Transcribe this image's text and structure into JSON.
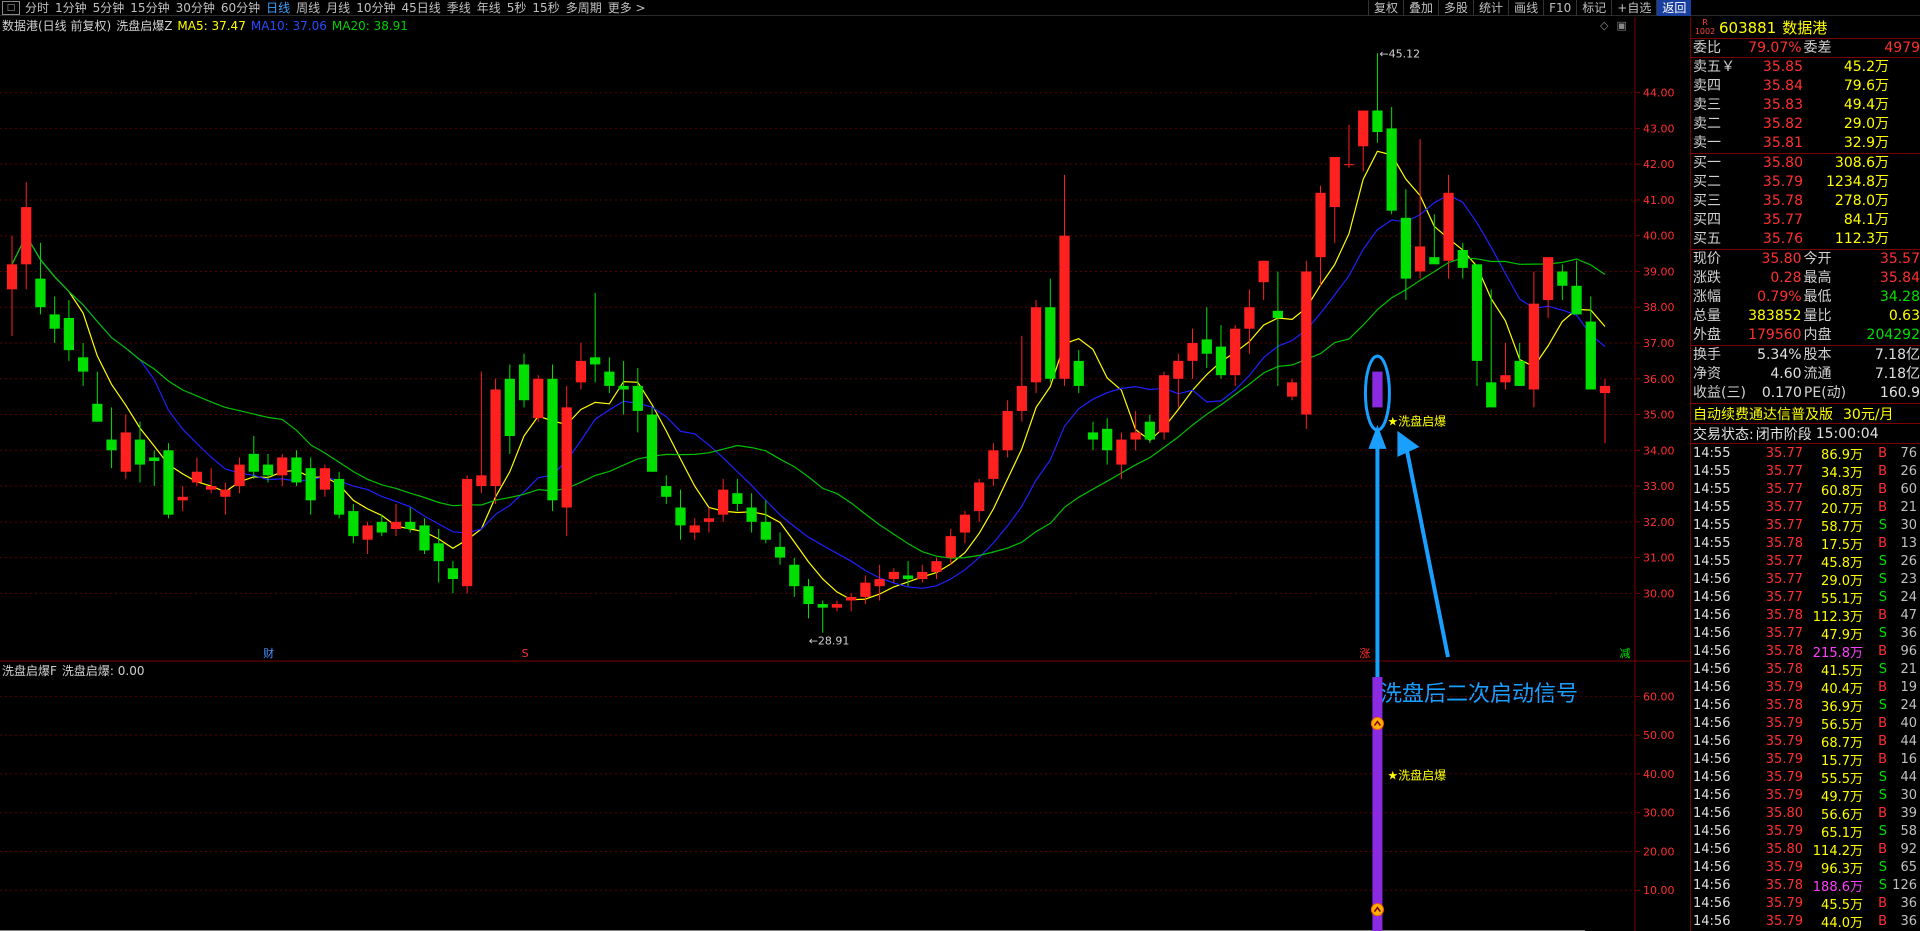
{
  "topbar": {
    "menu_icon": "menu-icon",
    "period_tabs": [
      "分时",
      "1分钟",
      "5分钟",
      "15分钟",
      "30分钟",
      "60分钟",
      "日线",
      "周线",
      "月线",
      "10分钟",
      "45日线",
      "季线",
      "年线",
      "5秒",
      "15秒",
      "多周期",
      "更多 >"
    ],
    "active_index": 6,
    "tool_tabs": [
      "复权",
      "叠加",
      "多股",
      "统计",
      "画线",
      "F10",
      "标记",
      "+自选",
      "返回"
    ]
  },
  "main_legend": {
    "name": "数据港(日线 前复权)",
    "indicator": "洗盘启爆Z",
    "ma5": "MA5: 37.47",
    "ma10": "MA10: 37.06",
    "ma20": "MA20: 38.91"
  },
  "sub_legend": {
    "name": "洗盘启爆F",
    "value": "洗盘启爆: 0.00"
  },
  "colors": {
    "up": "#ff2020",
    "down": "#00e000",
    "ma5": "#ffff00",
    "ma10": "#2020ff",
    "ma20": "#00c000",
    "signal": "#8a2be2",
    "annotation": "#1a9fff",
    "grid": "#5a0000"
  },
  "chart_data": [
    {
      "type": "candlestick",
      "title": "数据港(日线 前复权)",
      "ylim": [
        28.5,
        45.5
      ],
      "y_ticks": [
        "30.00",
        "31.00",
        "32.00",
        "33.00",
        "34.00",
        "35.00",
        "36.00",
        "37.00",
        "38.00",
        "39.00",
        "40.00",
        "41.00",
        "42.00",
        "43.00",
        "44.00"
      ],
      "candles": [
        [
          38.5,
          40.0,
          37.2,
          39.2
        ],
        [
          39.2,
          41.5,
          38.5,
          40.8
        ],
        [
          38.8,
          39.8,
          37.8,
          38.0
        ],
        [
          37.8,
          38.3,
          37.0,
          37.4
        ],
        [
          37.7,
          38.2,
          36.5,
          36.8
        ],
        [
          36.6,
          37.0,
          35.8,
          36.2
        ],
        [
          35.3,
          36.2,
          34.8,
          34.8
        ],
        [
          34.3,
          35.2,
          33.5,
          34.0
        ],
        [
          33.4,
          35.0,
          33.2,
          34.5
        ],
        [
          34.3,
          34.8,
          33.1,
          33.6
        ],
        [
          33.8,
          34.0,
          33.0,
          33.7
        ],
        [
          34.0,
          34.2,
          32.1,
          32.2
        ],
        [
          32.6,
          33.0,
          32.3,
          32.7
        ],
        [
          33.1,
          33.8,
          33.0,
          33.4
        ],
        [
          32.9,
          33.5,
          32.8,
          33.0
        ],
        [
          32.7,
          33.1,
          32.2,
          32.9
        ],
        [
          33.0,
          33.8,
          32.8,
          33.6
        ],
        [
          33.9,
          34.4,
          33.2,
          33.4
        ],
        [
          33.6,
          33.9,
          33.1,
          33.3
        ],
        [
          33.3,
          33.9,
          33.0,
          33.8
        ],
        [
          33.8,
          34.0,
          33.0,
          33.1
        ],
        [
          33.5,
          33.8,
          32.2,
          32.6
        ],
        [
          32.9,
          33.6,
          32.7,
          33.5
        ],
        [
          33.2,
          33.4,
          32.1,
          32.2
        ],
        [
          32.3,
          32.5,
          31.4,
          31.6
        ],
        [
          31.5,
          32.0,
          31.1,
          31.9
        ],
        [
          32.0,
          32.2,
          31.6,
          31.7
        ],
        [
          31.8,
          32.5,
          31.6,
          32.0
        ],
        [
          32.0,
          32.4,
          31.7,
          31.8
        ],
        [
          31.9,
          32.1,
          31.1,
          31.2
        ],
        [
          31.4,
          31.8,
          30.3,
          30.9
        ],
        [
          30.7,
          30.9,
          30.0,
          30.4
        ],
        [
          30.2,
          33.3,
          30.0,
          33.2
        ],
        [
          33.0,
          36.2,
          32.8,
          33.3
        ],
        [
          33.0,
          36.0,
          32.5,
          35.7
        ],
        [
          36.0,
          36.4,
          33.9,
          34.4
        ],
        [
          36.4,
          36.7,
          35.2,
          35.4
        ],
        [
          34.9,
          36.1,
          34.8,
          36.0
        ],
        [
          36.0,
          36.4,
          32.3,
          32.6
        ],
        [
          32.4,
          35.8,
          31.6,
          35.2
        ],
        [
          35.9,
          37.0,
          35.7,
          36.5
        ],
        [
          36.6,
          38.4,
          35.9,
          36.4
        ],
        [
          36.2,
          36.6,
          35.6,
          35.8
        ],
        [
          35.8,
          36.5,
          35.0,
          35.7
        ],
        [
          35.8,
          36.3,
          34.5,
          35.1
        ],
        [
          35.0,
          35.2,
          33.4,
          33.4
        ],
        [
          33.0,
          33.3,
          32.5,
          32.7
        ],
        [
          32.4,
          32.9,
          31.5,
          31.9
        ],
        [
          31.7,
          32.1,
          31.5,
          31.9
        ],
        [
          32.0,
          32.4,
          31.7,
          32.1
        ],
        [
          32.2,
          33.2,
          32.0,
          32.9
        ],
        [
          32.8,
          33.2,
          32.3,
          32.5
        ],
        [
          32.4,
          32.8,
          31.7,
          32.0
        ],
        [
          32.0,
          32.6,
          31.4,
          31.5
        ],
        [
          31.3,
          31.7,
          30.8,
          31.0
        ],
        [
          30.8,
          31.0,
          29.9,
          30.2
        ],
        [
          30.2,
          30.4,
          29.3,
          29.7
        ],
        [
          29.7,
          29.8,
          28.9,
          29.6
        ],
        [
          29.6,
          29.8,
          29.5,
          29.7
        ],
        [
          29.8,
          30.0,
          29.5,
          29.9
        ],
        [
          29.9,
          30.5,
          29.7,
          30.3
        ],
        [
          30.2,
          30.8,
          29.8,
          30.4
        ],
        [
          30.4,
          30.7,
          30.3,
          30.6
        ],
        [
          30.5,
          30.9,
          30.2,
          30.4
        ],
        [
          30.4,
          30.8,
          30.3,
          30.6
        ],
        [
          30.6,
          31.0,
          30.4,
          30.9
        ],
        [
          31.0,
          31.8,
          30.8,
          31.6
        ],
        [
          31.7,
          32.3,
          31.4,
          32.2
        ],
        [
          32.3,
          33.2,
          32.0,
          33.1
        ],
        [
          33.2,
          34.2,
          33.0,
          34.0
        ],
        [
          34.0,
          35.4,
          33.8,
          35.1
        ],
        [
          35.1,
          37.2,
          34.8,
          35.8
        ],
        [
          35.9,
          38.2,
          35.6,
          38.0
        ],
        [
          38.0,
          38.8,
          35.9,
          36.0
        ],
        [
          36.0,
          41.7,
          35.8,
          40.0
        ],
        [
          36.5,
          36.8,
          35.6,
          35.8
        ],
        [
          34.5,
          34.8,
          34.0,
          34.3
        ],
        [
          34.6,
          34.9,
          33.6,
          34.0
        ],
        [
          33.6,
          34.5,
          33.2,
          34.3
        ],
        [
          34.3,
          35.1,
          34.0,
          34.5
        ],
        [
          34.8,
          35.0,
          34.2,
          34.3
        ],
        [
          34.5,
          36.2,
          34.3,
          36.1
        ],
        [
          36.0,
          36.7,
          35.2,
          36.5
        ],
        [
          36.5,
          37.4,
          36.0,
          37.0
        ],
        [
          37.1,
          38.0,
          36.3,
          36.7
        ],
        [
          36.9,
          37.5,
          36.0,
          36.1
        ],
        [
          36.1,
          37.5,
          35.8,
          37.4
        ],
        [
          37.4,
          38.5,
          36.7,
          38.0
        ],
        [
          38.7,
          39.2,
          38.2,
          39.3
        ],
        [
          37.9,
          39.0,
          35.8,
          37.7
        ],
        [
          35.5,
          36.0,
          35.4,
          35.9
        ],
        [
          35.0,
          39.3,
          34.6,
          39.0
        ],
        [
          39.4,
          41.4,
          38.6,
          41.2
        ],
        [
          40.8,
          42.1,
          39.8,
          42.2
        ],
        [
          42.0,
          43.1,
          41.9,
          42.0
        ],
        [
          42.5,
          43.5,
          41.8,
          43.5
        ],
        [
          43.5,
          45.1,
          42.6,
          42.9
        ],
        [
          43.0,
          43.6,
          40.6,
          40.7
        ],
        [
          40.5,
          41.3,
          38.2,
          38.8
        ],
        [
          39.0,
          42.7,
          38.8,
          39.7
        ],
        [
          39.4,
          40.6,
          39.3,
          39.2
        ],
        [
          39.3,
          41.7,
          38.8,
          41.2
        ],
        [
          39.6,
          39.8,
          38.8,
          39.1
        ],
        [
          39.2,
          38.6,
          35.8,
          36.5
        ],
        [
          35.9,
          38.5,
          35.7,
          35.2
        ],
        [
          35.9,
          37.0,
          35.7,
          36.1
        ],
        [
          36.5,
          37.0,
          35.8,
          35.8
        ],
        [
          35.7,
          39.0,
          35.2,
          38.1
        ],
        [
          38.2,
          39.4,
          37.7,
          39.4
        ],
        [
          39.0,
          39.2,
          38.2,
          38.6
        ],
        [
          38.6,
          39.3,
          37.8,
          37.8
        ],
        [
          37.6,
          38.3,
          36.7,
          35.7
        ],
        [
          35.6,
          36.0,
          34.2,
          35.8
        ]
      ],
      "labels": [
        {
          "text": "45.12",
          "kind": "high"
        },
        {
          "text": "28.91",
          "kind": "low"
        },
        {
          "text": "财",
          "kind": "event"
        },
        {
          "text": "S",
          "kind": "event"
        },
        {
          "text": "涨",
          "kind": "event"
        },
        {
          "text": "减",
          "kind": "event"
        },
        {
          "text": "洗盘启爆",
          "kind": "signal"
        }
      ]
    },
    {
      "type": "bar",
      "title": "洗盘启爆F",
      "ylim": [
        0,
        65
      ],
      "y_ticks": [
        "10.00",
        "20.00",
        "30.00",
        "40.00",
        "50.00",
        "60.00"
      ],
      "signal_index": 96,
      "signal_value": 65,
      "label": "洗盘启爆"
    }
  ],
  "annotation": {
    "text": "洗盘后二次启动信号"
  },
  "quote": {
    "badge": "R\n1002",
    "code": "603881",
    "name": "数据港",
    "weibi": {
      "label": "委比",
      "value": "79.07%",
      "label2": "委差",
      "value2": "4979"
    },
    "sell": [
      {
        "label": "卖五￥",
        "price": "35.85",
        "vol": "45.2万"
      },
      {
        "label": "卖四",
        "price": "35.84",
        "vol": "79.6万"
      },
      {
        "label": "卖三",
        "price": "35.83",
        "vol": "49.4万"
      },
      {
        "label": "卖二",
        "price": "35.82",
        "vol": "29.0万"
      },
      {
        "label": "卖一",
        "price": "35.81",
        "vol": "32.9万"
      }
    ],
    "buy": [
      {
        "label": "买一",
        "price": "35.80",
        "vol": "308.6万"
      },
      {
        "label": "买二",
        "price": "35.79",
        "vol": "1234.8万"
      },
      {
        "label": "买三",
        "price": "35.78",
        "vol": "278.0万"
      },
      {
        "label": "买四",
        "price": "35.77",
        "vol": "84.1万"
      },
      {
        "label": "买五",
        "price": "35.76",
        "vol": "112.3万"
      }
    ],
    "stats1": [
      {
        "l1": "现价",
        "v1": "35.80",
        "c1": "red",
        "l2": "今开",
        "v2": "35.57",
        "c2": "red"
      },
      {
        "l1": "涨跌",
        "v1": "0.28",
        "c1": "red",
        "l2": "最高",
        "v2": "35.84",
        "c2": "red"
      },
      {
        "l1": "涨幅",
        "v1": "0.79%",
        "c1": "red",
        "l2": "最低",
        "v2": "34.28",
        "c2": "green"
      },
      {
        "l1": "总量",
        "v1": "383852",
        "c1": "yellow",
        "l2": "量比",
        "v2": "0.63",
        "c2": "yellow"
      },
      {
        "l1": "外盘",
        "v1": "179560",
        "c1": "red",
        "l2": "内盘",
        "v2": "204292",
        "c2": "green"
      }
    ],
    "stats2": [
      {
        "l1": "换手",
        "v1": "5.34%",
        "c1": "white",
        "l2": "股本",
        "v2": "7.18亿",
        "c2": "white"
      },
      {
        "l1": "净资",
        "v1": "4.60",
        "c1": "white",
        "l2": "流通",
        "v2": "7.18亿",
        "c2": "white"
      },
      {
        "l1": "收益(三)",
        "v1": "0.170",
        "c1": "white",
        "l2": "PE(动)",
        "v2": "160.9",
        "c2": "white"
      }
    ],
    "ad_text": "自动续费通达信普及版",
    "ad_price": "30元/月",
    "status_label": "交易状态:",
    "status_value": "闭市阶段",
    "status_time": "15:00:04",
    "ticks": [
      {
        "time": "14:55",
        "price": "35.77",
        "vol": "86.9万",
        "bs": "B",
        "cnt": "76"
      },
      {
        "time": "14:55",
        "price": "35.77",
        "vol": "34.3万",
        "bs": "B",
        "cnt": "26"
      },
      {
        "time": "14:55",
        "price": "35.77",
        "vol": "60.8万",
        "bs": "B",
        "cnt": "60"
      },
      {
        "time": "14:55",
        "price": "35.77",
        "vol": "20.7万",
        "bs": "B",
        "cnt": "21"
      },
      {
        "time": "14:55",
        "price": "35.77",
        "vol": "58.7万",
        "bs": "S",
        "cnt": "30"
      },
      {
        "time": "14:55",
        "price": "35.78",
        "vol": "17.5万",
        "bs": "B",
        "cnt": "13"
      },
      {
        "time": "14:55",
        "price": "35.77",
        "vol": "45.8万",
        "bs": "S",
        "cnt": "26"
      },
      {
        "time": "14:56",
        "price": "35.77",
        "vol": "29.0万",
        "bs": "S",
        "cnt": "23"
      },
      {
        "time": "14:56",
        "price": "35.77",
        "vol": "55.1万",
        "bs": "S",
        "cnt": "24"
      },
      {
        "time": "14:56",
        "price": "35.78",
        "vol": "112.3万",
        "bs": "B",
        "cnt": "47"
      },
      {
        "time": "14:56",
        "price": "35.77",
        "vol": "47.9万",
        "bs": "S",
        "cnt": "36"
      },
      {
        "time": "14:56",
        "price": "35.78",
        "vol": "215.8万",
        "bs": "B",
        "cnt": "96"
      },
      {
        "time": "14:56",
        "price": "35.78",
        "vol": "41.5万",
        "bs": "S",
        "cnt": "21"
      },
      {
        "time": "14:56",
        "price": "35.79",
        "vol": "40.4万",
        "bs": "B",
        "cnt": "19"
      },
      {
        "time": "14:56",
        "price": "35.78",
        "vol": "36.9万",
        "bs": "S",
        "cnt": "24"
      },
      {
        "time": "14:56",
        "price": "35.79",
        "vol": "56.5万",
        "bs": "B",
        "cnt": "40"
      },
      {
        "time": "14:56",
        "price": "35.79",
        "vol": "68.7万",
        "bs": "B",
        "cnt": "44"
      },
      {
        "time": "14:56",
        "price": "35.79",
        "vol": "15.7万",
        "bs": "B",
        "cnt": "16"
      },
      {
        "time": "14:56",
        "price": "35.79",
        "vol": "55.5万",
        "bs": "S",
        "cnt": "44"
      },
      {
        "time": "14:56",
        "price": "35.79",
        "vol": "49.7万",
        "bs": "S",
        "cnt": "30"
      },
      {
        "time": "14:56",
        "price": "35.80",
        "vol": "56.6万",
        "bs": "B",
        "cnt": "39"
      },
      {
        "time": "14:56",
        "price": "35.79",
        "vol": "65.1万",
        "bs": "S",
        "cnt": "58"
      },
      {
        "time": "14:56",
        "price": "35.80",
        "vol": "114.2万",
        "bs": "B",
        "cnt": "92"
      },
      {
        "time": "14:56",
        "price": "35.79",
        "vol": "96.3万",
        "bs": "S",
        "cnt": "65"
      },
      {
        "time": "14:56",
        "price": "35.78",
        "vol": "188.6万",
        "bs": "S",
        "cnt": "126"
      },
      {
        "time": "14:56",
        "price": "35.79",
        "vol": "45.5万",
        "bs": "B",
        "cnt": "36"
      },
      {
        "time": "14:56",
        "price": "35.79",
        "vol": "44.0万",
        "bs": "B",
        "cnt": "36"
      }
    ]
  }
}
